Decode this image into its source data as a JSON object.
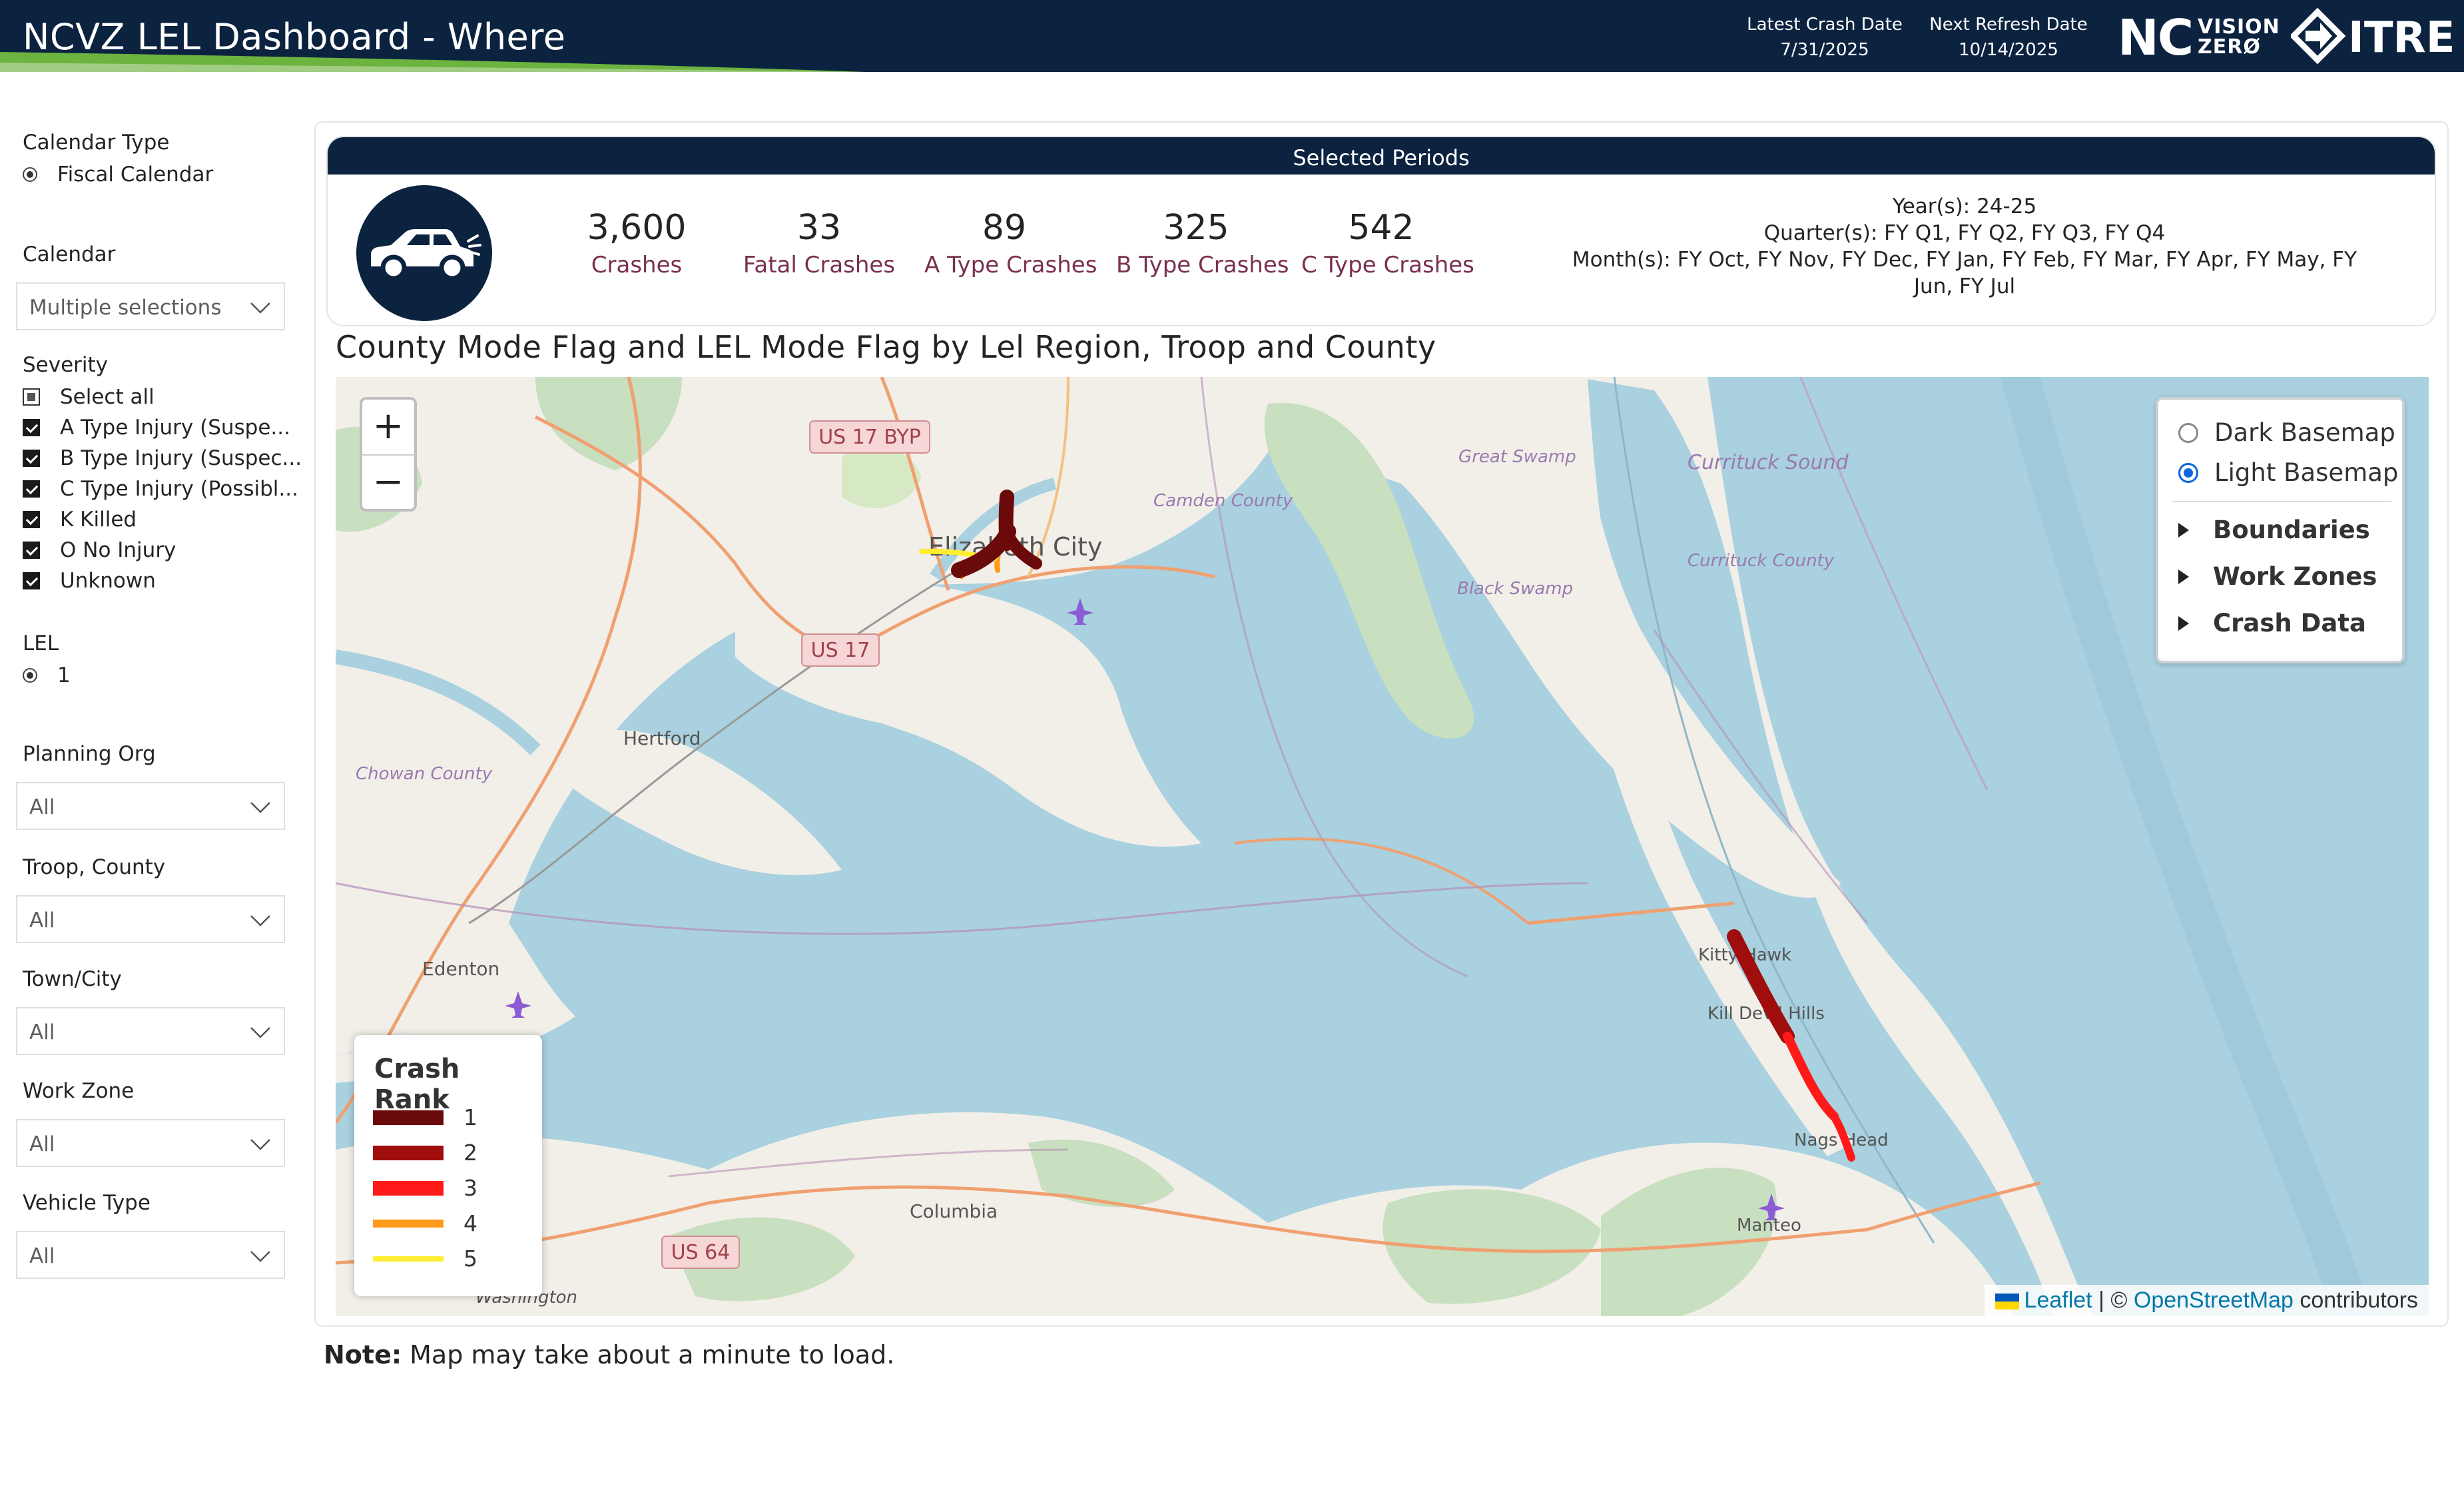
{
  "header": {
    "title": "NCVZ LEL Dashboard - Where",
    "latest_crash_label": "Latest Crash Date",
    "latest_crash_value": "7/31/2025",
    "next_refresh_label": "Next Refresh Date",
    "next_refresh_value": "10/14/2025",
    "logo_nc": "NC",
    "logo_vision": "VISION",
    "logo_zero": "ZERØ",
    "logo_itre": "ITRE",
    "colors": {
      "navy": "#0c2340",
      "green": "#6db33f"
    }
  },
  "filters": {
    "calendar_type": {
      "label": "Calendar Type",
      "option": "Fiscal Calendar"
    },
    "calendar": {
      "label": "Calendar",
      "value": "Multiple selections"
    },
    "severity": {
      "label": "Severity",
      "items": [
        "Select all",
        "A Type Injury (Suspe...",
        "B Type Injury (Suspec...",
        "C Type Injury (Possibl...",
        "K Killed",
        "O No Injury",
        "Unknown"
      ]
    },
    "lel": {
      "label": "LEL",
      "option": "1"
    },
    "planning_org": {
      "label": "Planning Org",
      "value": "All"
    },
    "troop_county": {
      "label": "Troop, County",
      "value": "All"
    },
    "town_city": {
      "label": "Town/City",
      "value": "All"
    },
    "work_zone": {
      "label": "Work Zone",
      "value": "All"
    },
    "vehicle_type": {
      "label": "Vehicle Type",
      "value": "All"
    }
  },
  "kpis": {
    "header": "Selected Periods",
    "crashes": {
      "value": "3,600",
      "label": "Crashes"
    },
    "fatal": {
      "value": "33",
      "label": "Fatal Crashes"
    },
    "a_type": {
      "value": "89",
      "label": "A Type Crashes"
    },
    "b_type": {
      "value": "325",
      "label": "B Type Crashes"
    },
    "c_type": {
      "value": "542",
      "label": "C Type Crashes"
    },
    "years": "Year(s): 24-25",
    "quarters": "Quarter(s): FY Q1, FY Q2, FY Q3, FY Q4",
    "months_1": "Month(s): FY Oct, FY Nov, FY Dec, FY Jan, FY Feb, FY Mar, FY Apr, FY May, FY",
    "months_2": "Jun, FY Jul",
    "car_icon": "car-icon"
  },
  "map": {
    "title": "County Mode Flag and LEL Mode Flag by Lel Region, Troop and County",
    "zoom_in": "+",
    "zoom_out": "−",
    "basemaps": [
      "Dark Basemap",
      "Light Basemap"
    ],
    "selected_basemap": "Light Basemap",
    "layer_groups": [
      "Boundaries",
      "Work Zones",
      "Crash Data"
    ],
    "legend_title": "Crash Rank",
    "legend": [
      {
        "label": "1",
        "color": "#6b0a0a"
      },
      {
        "label": "2",
        "color": "#a00d0d"
      },
      {
        "label": "3",
        "color": "#ff1a1a"
      },
      {
        "label": "4",
        "color": "#ff9a1a"
      },
      {
        "label": "5",
        "color": "#ffee33"
      }
    ],
    "places": {
      "elizabeth_city": "Elizabeth City",
      "camden": "Camden County",
      "currituck_sound": "Currituck Sound",
      "currituck_county": "Currituck County",
      "great_swamp": "Great Swamp",
      "black_swamp": "Black Swamp",
      "hertford": "Hertford",
      "chowan": "Chowan County",
      "edenton": "Edenton",
      "kitty_hawk": "Kitty Hawk",
      "kill_devil_hills": "Kill Devil Hills",
      "nags_head": "Nags Head",
      "manteo": "Manteo",
      "columbia": "Columbia",
      "washington": "Washington",
      "us17byp": "US 17 BYP",
      "us17": "US 17",
      "us64": "US 64"
    },
    "attribution": {
      "leaflet": "Leaflet",
      "sep": " | © ",
      "osm": "OpenStreetMap",
      "contrib": " contributors"
    }
  },
  "note": {
    "bold": "Note:",
    "text": " Map may take about a minute to load."
  }
}
